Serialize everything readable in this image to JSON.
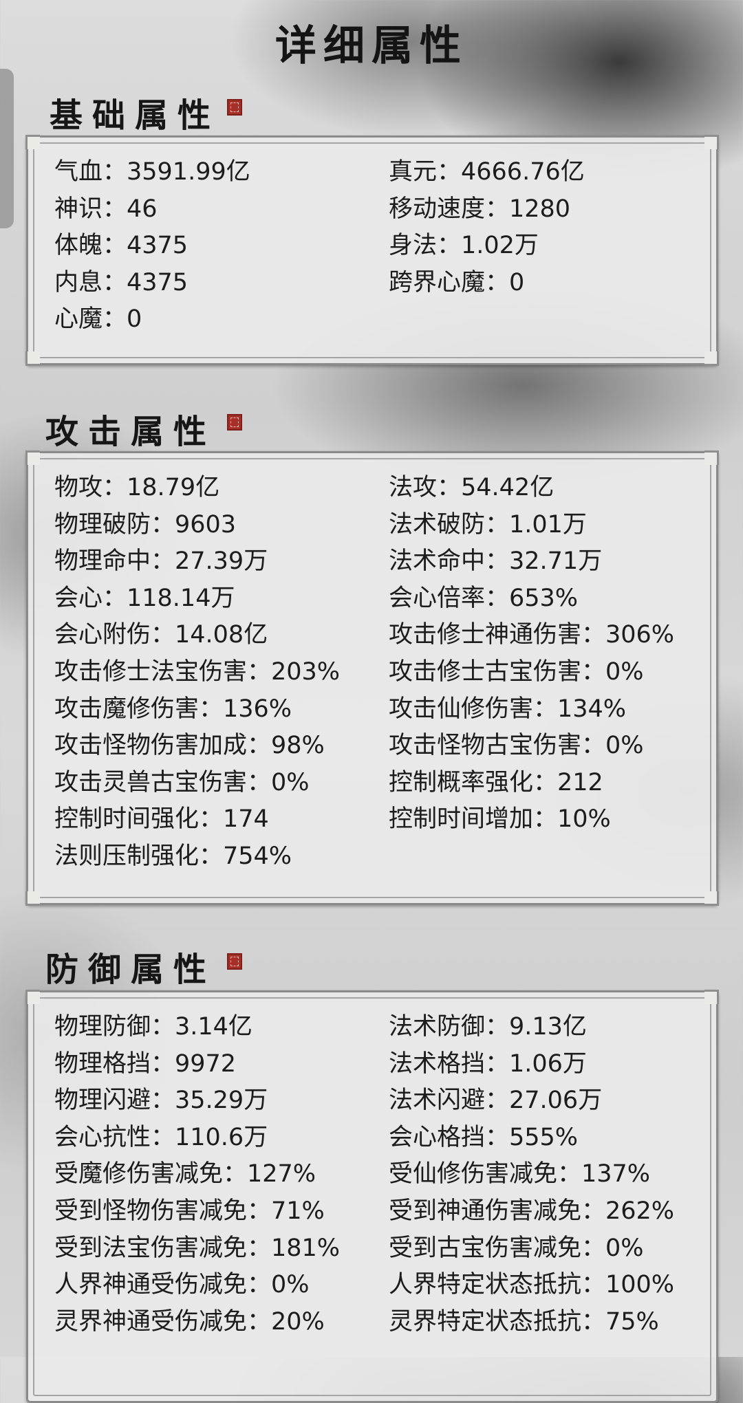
{
  "page_title": "详细属性",
  "sections": [
    {
      "title": "基础属性",
      "items": [
        "气血：3591.99亿",
        "真元：4666.76亿",
        "神识：46",
        "移动速度：1280",
        "体魄：4375",
        "身法：1.02万",
        "内息：4375",
        "跨界心魔：0",
        "心魔：0"
      ]
    },
    {
      "title": "攻击属性",
      "items": [
        "物攻：18.79亿",
        "法攻：54.42亿",
        "物理破防：9603",
        "法术破防：1.01万",
        "物理命中：27.39万",
        "法术命中：32.71万",
        "会心：118.14万",
        "会心倍率：653%",
        "会心附伤：14.08亿",
        "攻击修士神通伤害：306%",
        "攻击修士法宝伤害：203%",
        "攻击修士古宝伤害：0%",
        "攻击魔修伤害：136%",
        "攻击仙修伤害：134%",
        "攻击怪物伤害加成：98%",
        "攻击怪物古宝伤害：0%",
        "攻击灵兽古宝伤害：0%",
        "控制概率强化：212",
        "控制时间强化：174",
        "控制时间增加：10%",
        "法则压制强化：754%"
      ]
    },
    {
      "title": "防御属性",
      "items": [
        "物理防御：3.14亿",
        "法术防御：9.13亿",
        "物理格挡：9972",
        "法术格挡：1.06万",
        "物理闪避：35.29万",
        "法术闪避：27.06万",
        "会心抗性：110.6万",
        "会心格挡：555%",
        "受魔修伤害减免：127%",
        "受仙修伤害减免：137%",
        "受到怪物伤害减免：71%",
        "受到神通伤害减免：262%",
        "受到法宝伤害减免：181%",
        "受到古宝伤害减免：0%",
        "人界神通受伤减免：0%",
        "人界特定状态抵抗：100%",
        "灵界神通受伤减免：20%",
        "灵界特定状态抵抗：75%"
      ]
    }
  ],
  "colors": {
    "seal": "#a5302a",
    "panel_border": "#8a8a8a",
    "panel_bg": "#eaeae9"
  },
  "icons": {
    "seal": "red-seal-stamp-icon"
  }
}
